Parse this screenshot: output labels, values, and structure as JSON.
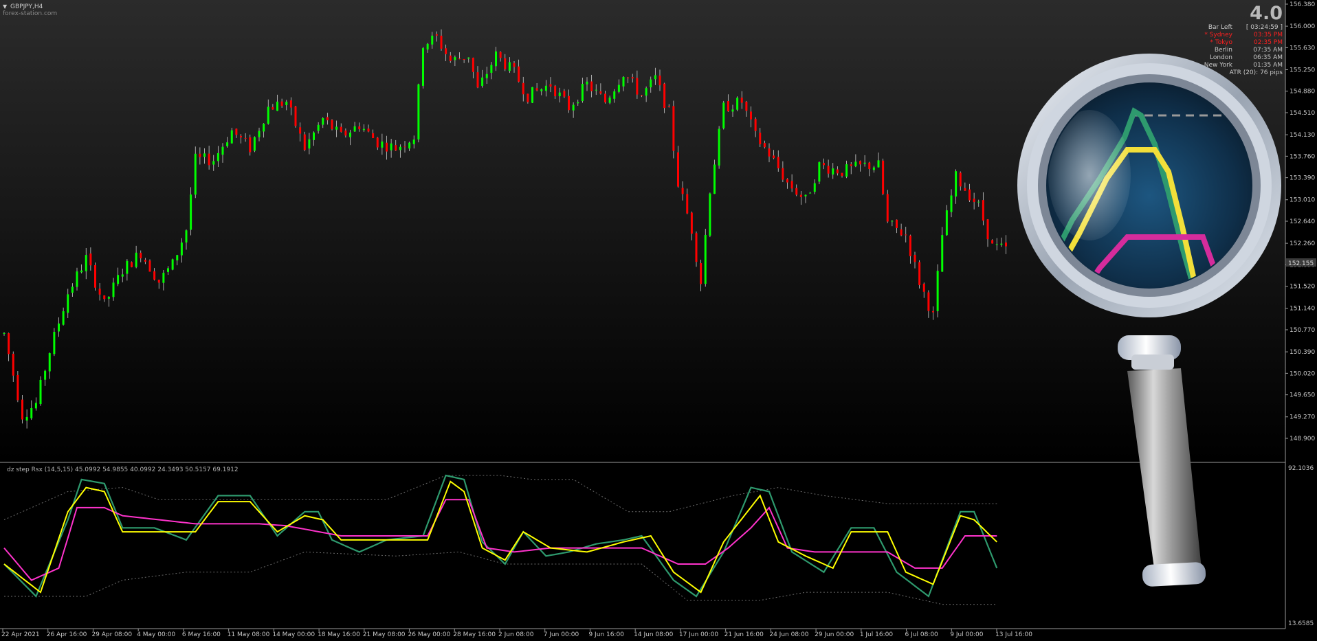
{
  "header": {
    "symbol": "GBPJPY,H4",
    "watermark": "forex-station.com",
    "version": "4.0"
  },
  "info_panel": {
    "bar_left_label": "Bar Left",
    "bar_left_value": "[ 03:24:59 ]",
    "sessions": [
      {
        "name": "* Sydney",
        "time": "03:35 PM",
        "active": true
      },
      {
        "name": "* Tokyo",
        "time": "02:35 PM",
        "active": true
      },
      {
        "name": "Berlin",
        "time": "07:35 AM",
        "active": false
      },
      {
        "name": "London",
        "time": "06:35 AM",
        "active": false
      },
      {
        "name": "New York",
        "time": "01:35 AM",
        "active": false
      }
    ],
    "atr": "ATR (20): 76 pips"
  },
  "colors": {
    "bull": "#00ff00",
    "bear": "#ff0000",
    "rsx_fast": "#ffff00",
    "rsx_slow": "#ff33cc",
    "rsx_base": "#2e9a6e",
    "levels": "#6b6b6b",
    "axis_text": "#c8c8c8"
  },
  "indicator": {
    "label": "dz step Rsx (14,5,15) 45.0992 54.9855 40.0992 24.3493 50.5157 69.1912",
    "max_label": "92.1036",
    "min_label": "13.6585"
  },
  "chart_data": {
    "type": "candlestick",
    "price_axis": {
      "ticks": [
        "156.380",
        "156.000",
        "155.630",
        "155.250",
        "154.880",
        "154.510",
        "154.130",
        "153.760",
        "153.390",
        "153.010",
        "152.640",
        "152.260",
        "151.890",
        "151.520",
        "151.140",
        "150.770",
        "150.390",
        "150.020",
        "149.650",
        "149.270",
        "148.900"
      ],
      "range": [
        148.9,
        156.38
      ]
    },
    "current_price": "152.155",
    "time_axis": [
      "22 Apr 2021",
      "26 Apr 16:00",
      "29 Apr 08:00",
      "4 May 00:00",
      "6 May 16:00",
      "11 May 08:00",
      "14 May 00:00",
      "18 May 16:00",
      "21 May 08:00",
      "26 May 00:00",
      "28 May 16:00",
      "2 Jun 08:00",
      "7 Jun 00:00",
      "9 Jun 16:00",
      "14 Jun 08:00",
      "17 Jun 00:00",
      "21 Jun 16:00",
      "24 Jun 08:00",
      "29 Jun 00:00",
      "1 Jul 16:00",
      "6 Jul 08:00",
      "9 Jul 00:00",
      "13 Jul 16:00"
    ],
    "price_path": [
      [
        0,
        150.7
      ],
      [
        4,
        149.3
      ],
      [
        7,
        149.5
      ],
      [
        10,
        150.4
      ],
      [
        14,
        151.4
      ],
      [
        18,
        152.0
      ],
      [
        20,
        151.6
      ],
      [
        22,
        151.2
      ],
      [
        26,
        151.8
      ],
      [
        30,
        152.1
      ],
      [
        34,
        151.6
      ],
      [
        37,
        151.9
      ],
      [
        40,
        152.5
      ],
      [
        42,
        153.7
      ],
      [
        46,
        153.7
      ],
      [
        50,
        154.2
      ],
      [
        54,
        153.9
      ],
      [
        58,
        154.6
      ],
      [
        62,
        154.7
      ],
      [
        66,
        153.9
      ],
      [
        70,
        154.4
      ],
      [
        74,
        154.1
      ],
      [
        78,
        154.3
      ],
      [
        82,
        154.0
      ],
      [
        86,
        153.9
      ],
      [
        90,
        154.1
      ],
      [
        92,
        155.7
      ],
      [
        95,
        155.8
      ],
      [
        98,
        155.4
      ],
      [
        102,
        155.5
      ],
      [
        104,
        154.9
      ],
      [
        108,
        155.5
      ],
      [
        112,
        155.2
      ],
      [
        115,
        154.8
      ],
      [
        120,
        155.0
      ],
      [
        124,
        154.6
      ],
      [
        128,
        155.0
      ],
      [
        132,
        154.7
      ],
      [
        136,
        155.2
      ],
      [
        140,
        154.8
      ],
      [
        143,
        155.1
      ],
      [
        146,
        154.5
      ],
      [
        148,
        153.3
      ],
      [
        151,
        152.5
      ],
      [
        153,
        151.6
      ],
      [
        155,
        153.2
      ],
      [
        158,
        154.6
      ],
      [
        162,
        154.7
      ],
      [
        165,
        154.1
      ],
      [
        168,
        153.8
      ],
      [
        172,
        153.3
      ],
      [
        176,
        153.0
      ],
      [
        179,
        153.6
      ],
      [
        184,
        153.5
      ],
      [
        189,
        153.6
      ],
      [
        192,
        153.6
      ],
      [
        194,
        152.6
      ],
      [
        198,
        152.4
      ],
      [
        201,
        151.6
      ],
      [
        204,
        151.0
      ],
      [
        206,
        152.4
      ],
      [
        209,
        153.4
      ],
      [
        212,
        153.1
      ],
      [
        214,
        152.9
      ],
      [
        217,
        152.2
      ],
      [
        220,
        152.155
      ]
    ],
    "rsx_fast": [
      [
        0,
        44
      ],
      [
        8,
        30
      ],
      [
        14,
        70
      ],
      [
        18,
        82
      ],
      [
        22,
        80
      ],
      [
        26,
        60
      ],
      [
        34,
        60
      ],
      [
        42,
        60
      ],
      [
        47,
        75
      ],
      [
        54,
        75
      ],
      [
        60,
        60
      ],
      [
        66,
        68
      ],
      [
        70,
        66
      ],
      [
        74,
        56
      ],
      [
        86,
        56
      ],
      [
        93,
        56
      ],
      [
        98,
        85
      ],
      [
        101,
        80
      ],
      [
        105,
        52
      ],
      [
        110,
        46
      ],
      [
        114,
        60
      ],
      [
        120,
        52
      ],
      [
        128,
        50
      ],
      [
        136,
        55
      ],
      [
        142,
        58
      ],
      [
        147,
        40
      ],
      [
        153,
        30
      ],
      [
        158,
        55
      ],
      [
        166,
        78
      ],
      [
        170,
        55
      ],
      [
        176,
        48
      ],
      [
        182,
        42
      ],
      [
        186,
        60
      ],
      [
        194,
        60
      ],
      [
        198,
        40
      ],
      [
        204,
        34
      ],
      [
        210,
        68
      ],
      [
        213,
        66
      ],
      [
        218,
        55
      ]
    ],
    "rsx_slow": [
      [
        0,
        52
      ],
      [
        6,
        36
      ],
      [
        12,
        42
      ],
      [
        16,
        72
      ],
      [
        22,
        72
      ],
      [
        26,
        68
      ],
      [
        34,
        66
      ],
      [
        42,
        64
      ],
      [
        48,
        64
      ],
      [
        56,
        64
      ],
      [
        62,
        63
      ],
      [
        74,
        58
      ],
      [
        86,
        58
      ],
      [
        93,
        58
      ],
      [
        97,
        76
      ],
      [
        102,
        76
      ],
      [
        106,
        52
      ],
      [
        112,
        50
      ],
      [
        120,
        52
      ],
      [
        130,
        52
      ],
      [
        136,
        52
      ],
      [
        140,
        52
      ],
      [
        148,
        44
      ],
      [
        154,
        44
      ],
      [
        159,
        52
      ],
      [
        164,
        62
      ],
      [
        168,
        72
      ],
      [
        172,
        52
      ],
      [
        178,
        50
      ],
      [
        186,
        50
      ],
      [
        194,
        50
      ],
      [
        200,
        42
      ],
      [
        206,
        42
      ],
      [
        211,
        58
      ],
      [
        218,
        58
      ]
    ],
    "rsx_base": [
      [
        0,
        44
      ],
      [
        7,
        28
      ],
      [
        14,
        66
      ],
      [
        17,
        86
      ],
      [
        22,
        84
      ],
      [
        26,
        62
      ],
      [
        33,
        62
      ],
      [
        40,
        56
      ],
      [
        47,
        78
      ],
      [
        54,
        78
      ],
      [
        60,
        58
      ],
      [
        66,
        70
      ],
      [
        69,
        70
      ],
      [
        72,
        56
      ],
      [
        78,
        50
      ],
      [
        84,
        56
      ],
      [
        92,
        58
      ],
      [
        97,
        88
      ],
      [
        101,
        86
      ],
      [
        105,
        55
      ],
      [
        110,
        44
      ],
      [
        114,
        60
      ],
      [
        119,
        48
      ],
      [
        124,
        50
      ],
      [
        130,
        54
      ],
      [
        136,
        56
      ],
      [
        140,
        58
      ],
      [
        147,
        36
      ],
      [
        152,
        28
      ],
      [
        158,
        50
      ],
      [
        164,
        82
      ],
      [
        168,
        80
      ],
      [
        173,
        50
      ],
      [
        180,
        40
      ],
      [
        186,
        62
      ],
      [
        191,
        62
      ],
      [
        196,
        40
      ],
      [
        203,
        28
      ],
      [
        210,
        70
      ],
      [
        213,
        70
      ],
      [
        218,
        42
      ]
    ],
    "level_upper": [
      [
        0,
        66
      ],
      [
        14,
        80
      ],
      [
        26,
        82
      ],
      [
        34,
        76
      ],
      [
        42,
        76
      ],
      [
        54,
        76
      ],
      [
        66,
        76
      ],
      [
        84,
        76
      ],
      [
        97,
        88
      ],
      [
        109,
        88
      ],
      [
        116,
        86
      ],
      [
        125,
        86
      ],
      [
        137,
        70
      ],
      [
        146,
        70
      ],
      [
        160,
        78
      ],
      [
        170,
        82
      ],
      [
        180,
        78
      ],
      [
        194,
        74
      ],
      [
        206,
        74
      ],
      [
        218,
        74
      ]
    ],
    "level_lower": [
      [
        0,
        28
      ],
      [
        18,
        28
      ],
      [
        26,
        36
      ],
      [
        40,
        40
      ],
      [
        54,
        40
      ],
      [
        66,
        50
      ],
      [
        86,
        48
      ],
      [
        100,
        50
      ],
      [
        110,
        44
      ],
      [
        140,
        44
      ],
      [
        150,
        26
      ],
      [
        166,
        26
      ],
      [
        176,
        30
      ],
      [
        194,
        30
      ],
      [
        206,
        24
      ],
      [
        218,
        24
      ]
    ],
    "indicator_axis": [
      "92.1036",
      "13.6585"
    ],
    "indicator_range": [
      13.6585,
      92.1036
    ]
  },
  "magnifier": {
    "description_icon": "magnifier-icon"
  }
}
